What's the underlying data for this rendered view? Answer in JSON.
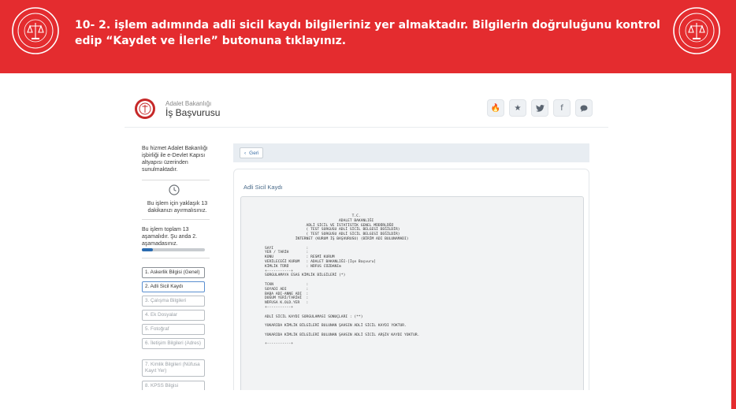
{
  "banner": {
    "text": "10- 2. işlem adımında adli sicil kaydı bilgileriniz yer almaktadır. Bilgilerin doğruluğunu kontrol edip “Kaydet ve İlerle” butonuna tıklayınız.",
    "color": "#e42c2f"
  },
  "app": {
    "brand_small": "Adalet Bakanlığı",
    "brand_big": "İş Başvurusu",
    "header_buttons": [
      {
        "icon": "flame-icon",
        "glyph": "🔥"
      },
      {
        "icon": "star-icon",
        "glyph": "★"
      },
      {
        "icon": "twitter-icon",
        "glyph": "🐦"
      },
      {
        "icon": "facebook-icon",
        "glyph": "f"
      },
      {
        "icon": "comment-icon",
        "glyph": "💬"
      }
    ]
  },
  "sidebar": {
    "intro": "Bu hizmet Adalet Bakanlığı işbirliği ile e-Devlet Kapısı altyapısı üzerinden sunulmaktadır.",
    "time_text": "Bu işlem için yaklaşık 13 dakikanızı ayırmalısınız.",
    "steps_text": "Bu işlem toplam 13 aşamalıdır. Şu anda 2. aşamadasınız.",
    "progress": 0.18,
    "steps": [
      {
        "label": "1. Askerlik Bilgisi (Genel)",
        "state": "done"
      },
      {
        "label": "2. Adli Sicil Kaydı",
        "state": "active"
      },
      {
        "label": "3. Çalışma Bilgileri",
        "state": "pending"
      },
      {
        "label": "4. Ek Dosyalar",
        "state": "pending"
      },
      {
        "label": "5. Fotoğraf",
        "state": "pending"
      },
      {
        "label": "6. İletişim Bilgileri (Adres)",
        "state": "pending"
      },
      {
        "label": "7. Kimlik Bilgileri (Nüfusa Kayıt Yer)",
        "state": "pending"
      },
      {
        "label": "8. KPSS Bilgisi",
        "state": "pending"
      }
    ]
  },
  "main": {
    "back_label": "Geri",
    "card_title": "Adli Sicil Kaydı",
    "document": "                                        T.C.\n                                  ADALET BAKANLIĞI\n                   ADLİ SİCİL VE İSTATİSTİK GENEL MÜDÜRLÜĞÜ\n                   ( TEST SORGUSU ADLİ SİCİL BELGESİ DEĞİLDİR)\n                   ( TEST SORGUSU ADLİ SİCİL BELGESİ DEĞİLDİR)\n              İNTERNET (KURUM İŞ BAŞVURUSU) (BİRİM ADI BULUNAMADI)\n\nSAYI               :\nYER / TARİH        :\nKONU               : RESMİ KURUM\nVERİLECEĞİ KURUM   : ADALET BAKANLIĞI-[İşe Başvuru]\nKİMLİK TÜRÜ        : NÜFUS CÜZDANIm\n+-----------+\nSORGULAMAYA ESAS KİMLİK BİLGİLERİ (*)\n\nTCKN               :\nSOYADI ADI         :\nBABA ADI-ANNE ADI  :\nDOĞUM YERİ/TARİHİ  :\nNÜFUSA K.OLD.YER   :\n+-----------+\n\nADLİ SİCİL KAYDI SORGULAMASI SONUÇLARI : (**)\n\nYUKARIDA KİMLİK BİLGİLERİ BULUNAN ŞAHSIN ADLİ SİCİL KAYDI YOKTUR.\n\nYUKARIDA KİMLİK BİLGİLERİ BULUNAN ŞAHSIN ADLİ SİCİL ARŞİV KAYDI YOKTUR.\n\n+-----------+"
  }
}
